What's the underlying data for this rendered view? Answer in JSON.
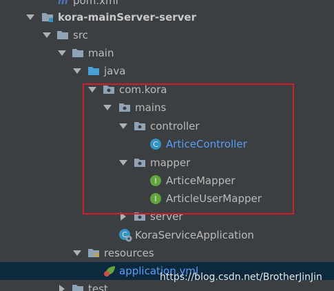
{
  "tree": {
    "items": [
      {
        "label": "pom.xml"
      },
      {
        "label": "kora-mainServer-server"
      },
      {
        "label": "src"
      },
      {
        "label": "main"
      },
      {
        "label": "java"
      },
      {
        "label": "com.kora"
      },
      {
        "label": "mains"
      },
      {
        "label": "controller"
      },
      {
        "label": "ArticeController"
      },
      {
        "label": "mapper"
      },
      {
        "label": "ArticeMapper"
      },
      {
        "label": "ArticleUserMapper"
      },
      {
        "label": "server"
      },
      {
        "label": "KoraServiceApplication"
      },
      {
        "label": "resources"
      },
      {
        "label": "application.yml"
      },
      {
        "label": "test"
      }
    ],
    "icon_letters": {
      "class": "C",
      "interface": "I"
    }
  },
  "watermark": "https://blog.csdn.net/BrotherJinJin",
  "colors": {
    "background": "#3c3f41",
    "selection": "#0d293e",
    "highlight_box": "#d1202a",
    "class_icon": "#3592c4",
    "interface_icon": "#62a53e",
    "folder": "#8fa3b5",
    "java_folder": "#4a9fd6"
  }
}
